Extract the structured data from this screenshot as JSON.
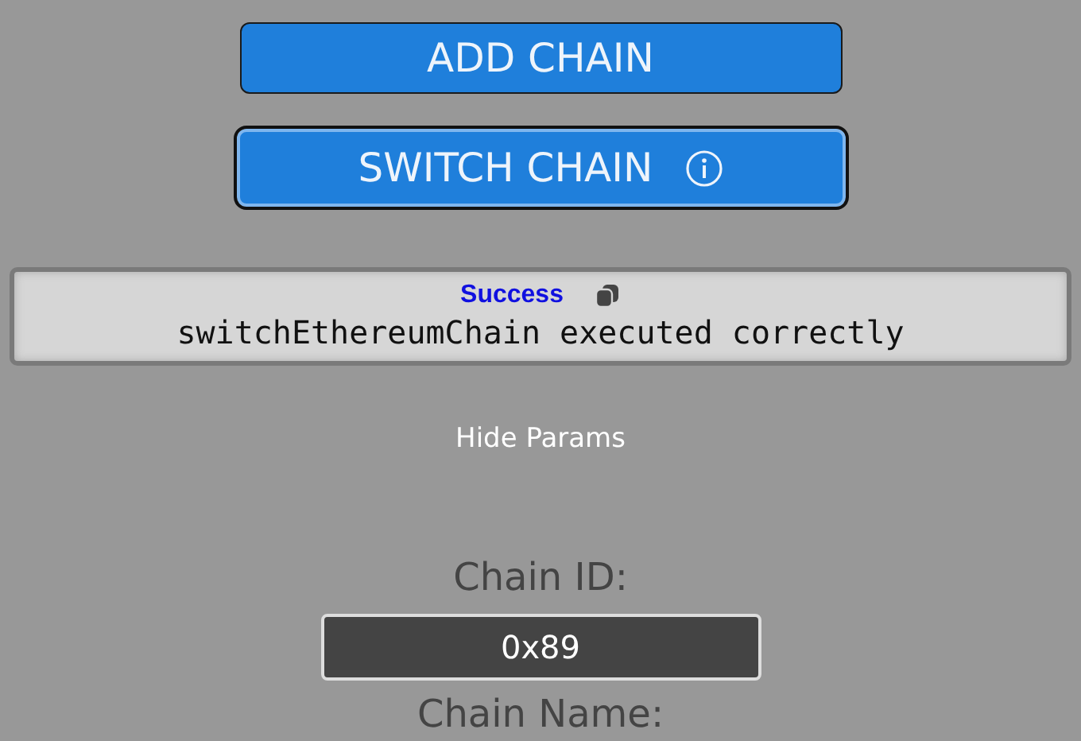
{
  "buttons": [
    {
      "label": "ADD CHAIN",
      "focused": false,
      "info": false
    },
    {
      "label": "SWITCH CHAIN",
      "focused": true,
      "info": true
    }
  ],
  "result": {
    "status": "Success",
    "message": "switchEthereumChain executed correctly"
  },
  "toggle_params": "Hide Params",
  "params": [
    {
      "label": "Chain ID:",
      "value": "0x89"
    },
    {
      "label": "Chain Name:"
    }
  ]
}
